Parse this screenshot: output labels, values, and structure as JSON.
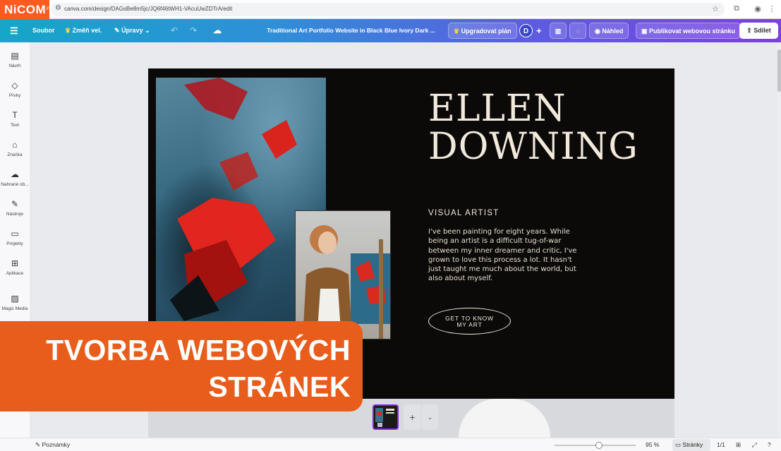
{
  "browser": {
    "brand": "NiCOM",
    "brand_mark": "IT",
    "url": "canva.com/design/DAGsBe8m5jc/JQ6f46tWH1-VAcuUwZDTrA/edit"
  },
  "toolbar": {
    "file": "Soubor",
    "resize": "Změň vel.",
    "edit": "Úpravy",
    "title": "Traditional Art Portfolio Website in Black  Blue  Ivory  Dark ...",
    "upgrade": "Upgradovat plán",
    "avatar": "D",
    "preview": "Náhled",
    "publish": "Publikovat webovou stránku",
    "share": "Sdílet"
  },
  "sidebar": {
    "items": [
      {
        "label": "Návrh",
        "icon": "design-icon"
      },
      {
        "label": "Prvky",
        "icon": "elements-icon"
      },
      {
        "label": "Text",
        "icon": "text-icon"
      },
      {
        "label": "Značka",
        "icon": "brand-icon"
      },
      {
        "label": "Nahrané ob...",
        "icon": "upload-icon"
      },
      {
        "label": "Nástroje",
        "icon": "tools-icon"
      },
      {
        "label": "Projekty",
        "icon": "folder-icon"
      },
      {
        "label": "Aplikace",
        "icon": "apps-icon"
      },
      {
        "label": "Magic Media",
        "icon": "magic-media-icon"
      }
    ]
  },
  "design": {
    "name_line1": "ELLEN",
    "name_line2": "DOWNING",
    "subtitle": "VISUAL ARTIST",
    "bio": "I've been painting for eight years. While being an artist is a difficult tug-of-war between my inner dreamer and critic, I've grown to love this process a lot. It hasn't just taught me much about the world, but also about myself.",
    "cta_line1": "GET TO KNOW",
    "cta_line2": "MY ART"
  },
  "banner": {
    "line1": "TVORBA WEBOVÝCH",
    "line2": "STRÁNEK"
  },
  "footer": {
    "notes": "Poznámky",
    "zoom": "95 %",
    "zoom_level": 0.55,
    "pages": "Stránky",
    "page_count": "1/1"
  }
}
